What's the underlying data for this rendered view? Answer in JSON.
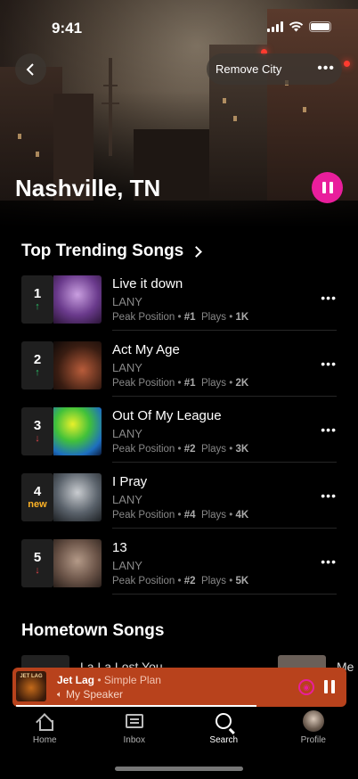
{
  "status_bar": {
    "time": "9:41"
  },
  "header": {
    "remove_label": "Remove City",
    "city": "Nashville, TN"
  },
  "top_trending": {
    "title": "Top Trending Songs",
    "songs": [
      {
        "rank": "1",
        "trend": "up",
        "trend_glyph": "↑",
        "title": "Live it down",
        "artist": "LANY",
        "peak_label": "Peak Position",
        "peak": "#1",
        "plays_label": "Plays",
        "plays": "1K"
      },
      {
        "rank": "2",
        "trend": "up",
        "trend_glyph": "↑",
        "title": "Act My Age",
        "artist": "LANY",
        "peak_label": "Peak Position",
        "peak": "#1",
        "plays_label": "Plays",
        "plays": "2K"
      },
      {
        "rank": "3",
        "trend": "down",
        "trend_glyph": "↓",
        "title": "Out Of My League",
        "artist": "LANY",
        "peak_label": "Peak Position",
        "peak": "#2",
        "plays_label": "Plays",
        "plays": "3K"
      },
      {
        "rank": "4",
        "trend": "new",
        "trend_glyph": "new",
        "title": "I Pray",
        "artist": "LANY",
        "peak_label": "Peak Position",
        "peak": "#4",
        "plays_label": "Plays",
        "plays": "4K"
      },
      {
        "rank": "5",
        "trend": "down",
        "trend_glyph": "↓",
        "title": "13",
        "artist": "LANY",
        "peak_label": "Peak Position",
        "peak": "#2",
        "plays_label": "Plays",
        "plays": "5K"
      }
    ]
  },
  "hometown": {
    "title": "Hometown Songs",
    "peek_1": "La La Lost You",
    "peek_2": "Me"
  },
  "mini_player": {
    "cover_text": "JET LAG",
    "title": "Jet Lag",
    "separator": " • ",
    "artist": "Simple Plan",
    "device": "My Speaker",
    "progress": 0.72
  },
  "tabs": [
    {
      "label": "Home",
      "icon": "home-icon"
    },
    {
      "label": "Inbox",
      "icon": "inbox-icon"
    },
    {
      "label": "Search",
      "icon": "search-icon"
    },
    {
      "label": "Profile",
      "icon": "avatar"
    }
  ],
  "colors": {
    "accent": "#e91e9c",
    "mini_player_bg": "#b8421c",
    "trend_up": "#2dc36b",
    "trend_down": "#e0464a",
    "trend_new": "#ffb326"
  }
}
